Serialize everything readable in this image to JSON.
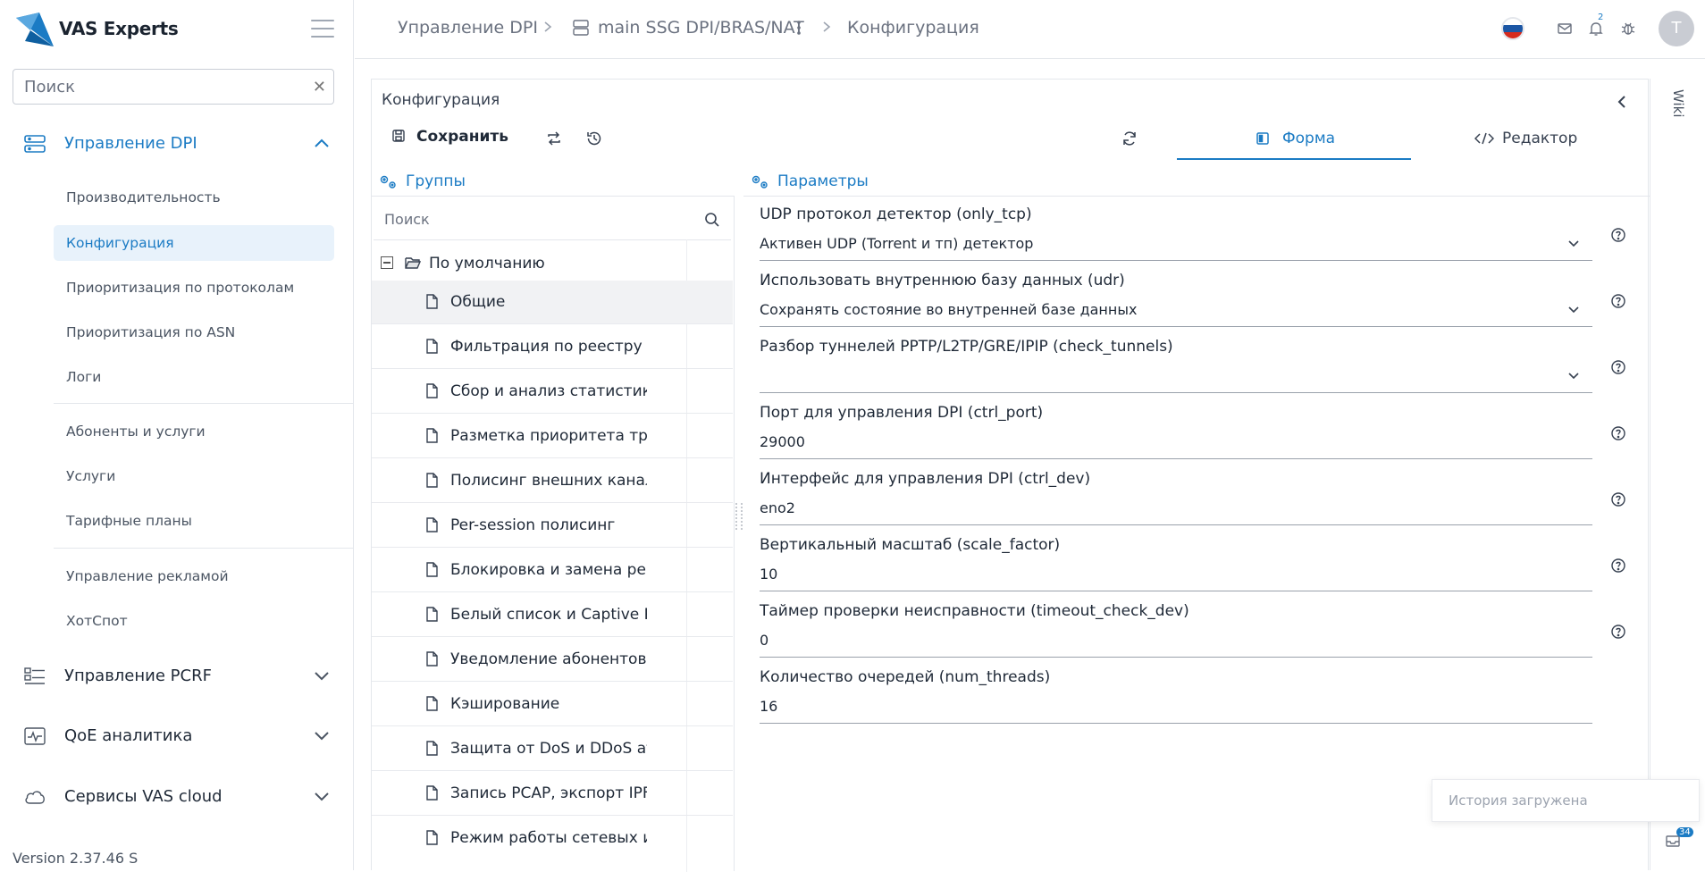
{
  "brand": {
    "name": "VAS Experts",
    "logo_icon": "vas-logo-icon"
  },
  "sidebar": {
    "search": {
      "placeholder": "Поиск"
    },
    "sections": [
      {
        "label": "Управление DPI",
        "icon": "server-icon",
        "expanded": true,
        "items": [
          {
            "label": "Производительность"
          },
          {
            "label": "Конфигурация",
            "active": true
          },
          {
            "label": "Приоритизация по протоколам"
          },
          {
            "label": "Приоритизация по ASN"
          },
          {
            "label": "Логи"
          },
          {
            "label": "Абоненты и услуги"
          },
          {
            "label": "Услуги"
          },
          {
            "label": "Тарифные планы"
          },
          {
            "label": "Управление рекламой"
          },
          {
            "label": "ХотСпот"
          }
        ]
      },
      {
        "label": "Управление PCRF",
        "icon": "pcrf-icon",
        "expanded": false
      },
      {
        "label": "QoE аналитика",
        "icon": "analytics-icon",
        "expanded": false
      },
      {
        "label": "Сервисы VAS cloud",
        "icon": "cloud-icon",
        "expanded": false
      }
    ],
    "version": "Version 2.37.46 S"
  },
  "breadcrumb": {
    "items": [
      "Управление DPI",
      "main SSG DPI/BRAS/NAT",
      "Конфигурация"
    ]
  },
  "topbar": {
    "notification_count": "2",
    "avatar_letter": "T"
  },
  "main": {
    "title": "Конфигурация",
    "toolbar": {
      "save_label": "Сохранить"
    },
    "tabs": [
      {
        "label": "Форма",
        "active": true
      },
      {
        "label": "Редактор",
        "active": false
      }
    ],
    "groups": {
      "header": "Группы",
      "search_placeholder": "Поиск",
      "root_label": "По умолчанию",
      "items": [
        "Общие",
        "Фильтрация по реестру запрещенных сайтов",
        "Сбор и анализ статистики по протоколам",
        "Разметка приоритета трафика",
        "Полисинг внешних каналов доступа",
        "Per-session полисинг",
        "Блокировка и замена рекламы",
        "Белый список и Captive Portal",
        "Уведомление абонентов",
        "Кэширование",
        "Защита от DoS и DDoS атак",
        "Запись PCAP, экспорт IPFIX (Клиенты)",
        "Режим работы сетевых интерфейсов"
      ]
    },
    "params": {
      "header": "Параметры",
      "fields": [
        {
          "label": "UDP протокол детектор (only_tcp)",
          "value": "Активен UDP (Torrent и тп) детектор",
          "type": "select"
        },
        {
          "label": "Использовать внутреннюю базу данных (udr)",
          "value": "Сохранять состояние во внутренней базе данных",
          "type": "select"
        },
        {
          "label": "Разбор туннелей PPTP/L2TP/GRE/IPIP (check_tunnels)",
          "value": "",
          "type": "select"
        },
        {
          "label": "Порт для управления DPI (ctrl_port)",
          "value": "29000",
          "type": "text"
        },
        {
          "label": "Интерфейс для управления DPI (ctrl_dev)",
          "value": "eno2",
          "type": "text"
        },
        {
          "label": "Вертикальный масштаб (scale_factor)",
          "value": "10",
          "type": "text"
        },
        {
          "label": "Таймер проверки неисправности (timeout_check_dev)",
          "value": "0",
          "type": "text"
        },
        {
          "label": "Количество очередей (num_threads)",
          "value": "16",
          "type": "text"
        }
      ]
    }
  },
  "wiki": {
    "label": "Wiki"
  },
  "toast": {
    "message": "История загружена"
  },
  "corner_badge": "34",
  "colors": {
    "accent": "#1b7bc4",
    "active_bg": "#e8f2fb"
  }
}
